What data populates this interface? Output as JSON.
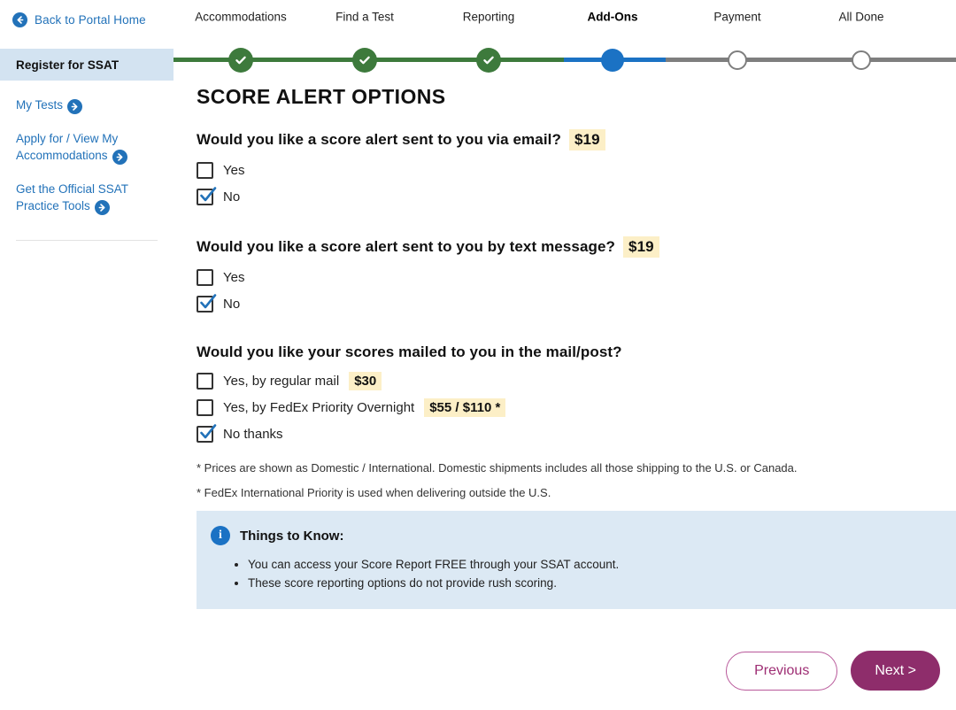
{
  "sidebar": {
    "back": {
      "label": "Back to Portal Home",
      "icon": "arrow-left-circle-icon"
    },
    "active_item": "Register for SSAT",
    "links": [
      {
        "label": "My Tests",
        "icon": "arrow-right-circle-icon"
      },
      {
        "label": "Apply for / View My Accommodations",
        "icon": "arrow-right-circle-icon"
      },
      {
        "label": "Get the Official SSAT Practice Tools",
        "icon": "arrow-right-circle-icon"
      }
    ]
  },
  "stepper": {
    "steps": [
      {
        "label": "Accommodations",
        "state": "done"
      },
      {
        "label": "Find a Test",
        "state": "done"
      },
      {
        "label": "Reporting",
        "state": "done"
      },
      {
        "label": "Add-Ons",
        "state": "current"
      },
      {
        "label": "Payment",
        "state": "todo"
      },
      {
        "label": "All Done",
        "state": "todo"
      }
    ],
    "colors": {
      "done": "#3D7A3C",
      "current": "#1B72C4",
      "todo": "#7E7E7E"
    }
  },
  "main": {
    "title": "SCORE ALERT OPTIONS",
    "questions": [
      {
        "text": "Would you like a score alert sent to you via email?",
        "price": "$19",
        "options": [
          {
            "label": "Yes",
            "checked": false
          },
          {
            "label": "No",
            "checked": true
          }
        ]
      },
      {
        "text": "Would you like a score alert sent to you by text message?",
        "price": "$19",
        "options": [
          {
            "label": "Yes",
            "checked": false
          },
          {
            "label": "No",
            "checked": true
          }
        ]
      },
      {
        "text": "Would you like your scores mailed to you in the mail/post?",
        "price": "",
        "options": [
          {
            "label": "Yes, by regular mail",
            "price": "$30",
            "checked": false
          },
          {
            "label": "Yes, by FedEx Priority Overnight",
            "price": "$55 / $110 *",
            "checked": false
          },
          {
            "label": "No thanks",
            "price": "",
            "checked": true
          }
        ]
      }
    ],
    "footnotes": [
      "* Prices are shown as Domestic / International. Domestic shipments includes all those shipping to the U.S. or Canada.",
      "* FedEx International Priority is used when delivering outside the U.S."
    ],
    "info_box": {
      "icon": "info-circle-icon",
      "title": "Things to Know:",
      "items": [
        "You can access your Score Report FREE through your SSAT account.",
        "These score reporting options do not provide rush scoring."
      ]
    }
  },
  "footer": {
    "previous_label": "Previous",
    "next_label": "Next >"
  },
  "colors": {
    "link_blue": "#2272B9",
    "sidebar_active_bg": "#D3E3F1",
    "price_highlight": "#FCEFC7",
    "info_bg": "#DCE9F4",
    "magenta": "#8E2D6B"
  }
}
